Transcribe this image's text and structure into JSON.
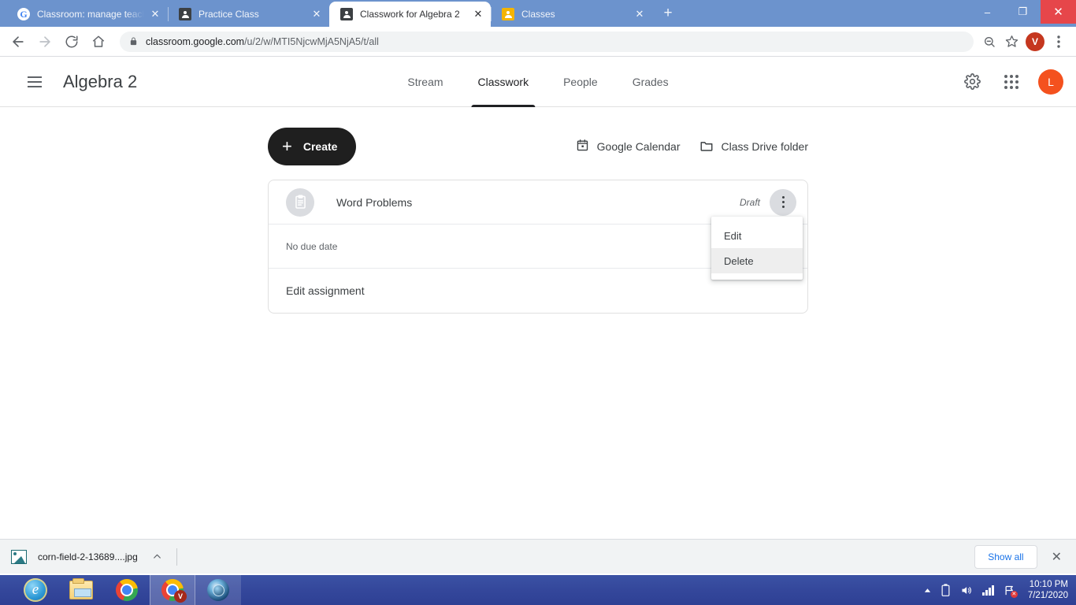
{
  "browser": {
    "tabs": [
      {
        "title": "Classroom: manage teaching and",
        "favicon": "google-icon",
        "active": false
      },
      {
        "title": "Practice Class",
        "favicon": "classroom-dark-icon",
        "active": false
      },
      {
        "title": "Classwork for Algebra 2",
        "favicon": "classroom-dark-icon",
        "active": true
      },
      {
        "title": "Classes",
        "favicon": "classroom-yellow-icon",
        "active": false
      }
    ],
    "new_tab_label": "+",
    "window_controls": {
      "minimize": "–",
      "maximize": "❐",
      "close": "✕"
    },
    "nav": {
      "back": "←",
      "forward": "→",
      "reload": "⟳",
      "home": "⌂"
    },
    "omnibox": {
      "host": "classroom.google.com",
      "path": "/u/2/w/MTI5NjcwMjA5NjA5/t/all",
      "full_url": "classroom.google.com/u/2/w/MTI5NjcwMjA5NjA5/t/all"
    },
    "profile_initial": "V",
    "accent_profile_color": "#c5371f"
  },
  "classroom": {
    "header": {
      "class_title": "Algebra 2",
      "tabs": [
        {
          "label": "Stream",
          "active": false
        },
        {
          "label": "Classwork",
          "active": true
        },
        {
          "label": "People",
          "active": false
        },
        {
          "label": "Grades",
          "active": false
        }
      ],
      "user_initial": "L",
      "user_avatar_color": "#f4511e"
    },
    "toolbar": {
      "create_label": "Create",
      "create_plus": "+",
      "google_calendar_label": "Google Calendar",
      "class_drive_label": "Class Drive folder"
    },
    "assignment": {
      "title": "Word Problems",
      "status": "Draft",
      "due": "No due date",
      "edit_link": "Edit assignment"
    },
    "dropdown": {
      "items": [
        {
          "label": "Edit",
          "hovered": false
        },
        {
          "label": "Delete",
          "hovered": true
        }
      ]
    },
    "help_glyph": "?"
  },
  "downloads": {
    "file_name": "corn-field-2-13689....jpg",
    "show_all_label": "Show all",
    "close_label": "✕"
  },
  "taskbar": {
    "apps": [
      {
        "name": "internet-explorer",
        "active": false
      },
      {
        "name": "file-explorer",
        "active": false
      },
      {
        "name": "google-chrome",
        "active": false
      },
      {
        "name": "google-chrome-profile",
        "active": true,
        "badge": "V"
      },
      {
        "name": "media-player",
        "active": false
      }
    ],
    "tray": {
      "time": "10:10 PM",
      "date": "7/21/2020"
    }
  }
}
